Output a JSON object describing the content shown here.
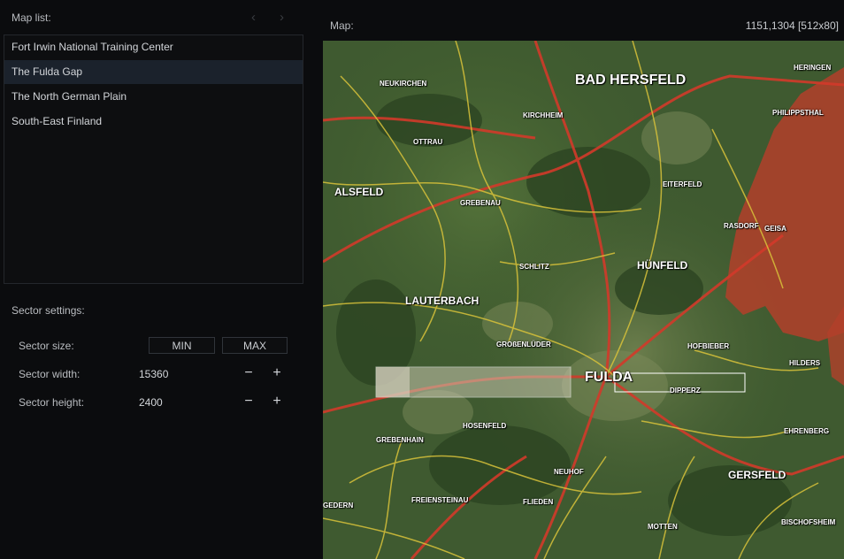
{
  "left": {
    "map_list_title": "Map list:",
    "nav_prev": "‹",
    "nav_next": "›",
    "maps": [
      {
        "name": "Fort Irwin National Training Center",
        "selected": false
      },
      {
        "name": "The Fulda Gap",
        "selected": true
      },
      {
        "name": "The North German Plain",
        "selected": false
      },
      {
        "name": "South-East Finland",
        "selected": false
      }
    ],
    "sector_settings_title": "Sector settings:",
    "sector_size_label": "Sector size:",
    "min_label": "MIN",
    "max_label": "MAX",
    "sector_width_label": "Sector width:",
    "sector_width_value": "15360",
    "sector_height_label": "Sector height:",
    "sector_height_value": "2400",
    "minus": "−",
    "plus": "+"
  },
  "map": {
    "title": "Map:",
    "coords": "1151,1304 [512x80]",
    "towns": {
      "bad_hersfeld": "BAD HERSFELD",
      "heringen": "HERINGEN",
      "neukirchen": "NEUKIRCHEN",
      "kirchheim": "KIRCHHEIM",
      "philippsthal": "PHILIPPSTHAL",
      "ottrau": "OTTRAU",
      "alsfeld": "ALSFELD",
      "grebenau": "GREBENAU",
      "eiterfeld": "EITERFELD",
      "rasdorf": "RASDORF",
      "geisa": "GEISA",
      "schlitz": "SCHLITZ",
      "hunfeld": "HÜNFELD",
      "lauterbach": "LAUTERBACH",
      "grossenluder": "GROßENLÜDER",
      "hofbieber": "HOFBIEBER",
      "hilders": "HILDERS",
      "fulda": "FULDA",
      "dipperz": "DIPPERZ",
      "hosenfeld": "HOSENFELD",
      "grebenhain": "GREBENHAIN",
      "ehrenberg": "EHRENBERG",
      "neuhof": "NEUHOF",
      "gersfeld": "GERSFELD",
      "freiensteinau": "FREIENSTEINAU",
      "flieden": "FLIEDEN",
      "gedern": "GEDERN",
      "motten": "MOTTEN",
      "bischofsheim": "BISCHOFSHEIM"
    }
  }
}
